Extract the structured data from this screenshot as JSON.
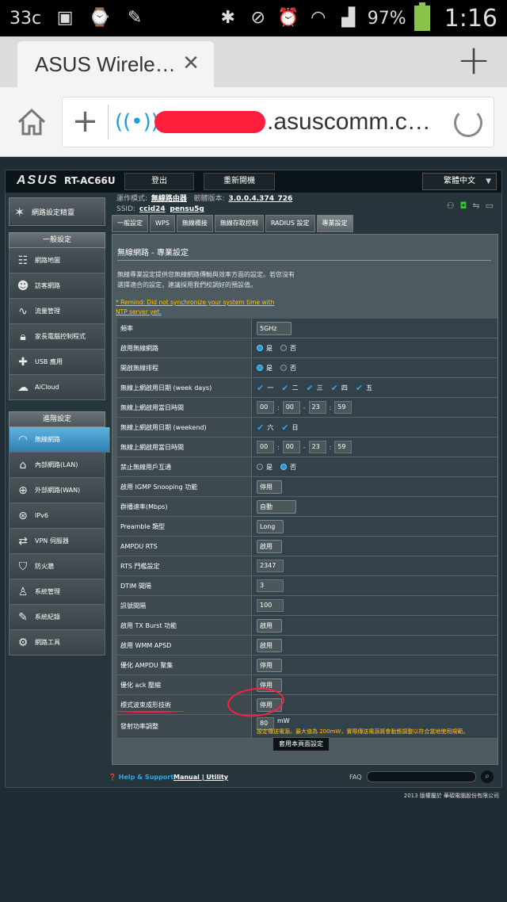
{
  "status_bar": {
    "temp": "33c",
    "battery": "97%",
    "time": "1:16"
  },
  "browser": {
    "tab_title": "ASUS Wirele…",
    "url": ".asuscomm.c…"
  },
  "router": {
    "logo": "ASUS",
    "model": "RT-AC66U",
    "logout": "登出",
    "reboot": "重新開機",
    "language": "繁體中文",
    "op_mode_label": "運作模式:",
    "op_mode": "無線路由器",
    "fw_label": "韌體版本:",
    "fw": "3.0.0.4.374_726",
    "ssid_label": "SSID:",
    "ssid1": "ccid24",
    "ssid2": "pensu5g"
  },
  "sidebar": {
    "wizard": "網路設定精靈",
    "general_head": "一般設定",
    "general": [
      "網路地圖",
      "訪客網路",
      "流量管理",
      "家長電腦控制程式",
      "USB 應用",
      "AiCloud"
    ],
    "advanced_head": "進階設定",
    "advanced": [
      "無線網路",
      "內部網路(LAN)",
      "外部網路(WAN)",
      "IPv6",
      "VPN 伺服器",
      "防火牆",
      "系統管理",
      "系統紀錄",
      "網路工具"
    ]
  },
  "tabs": [
    "一般設定",
    "WPS",
    "無線橋接",
    "無線存取控制",
    "RADIUS 設定",
    "專業設定"
  ],
  "page": {
    "title": "無線網路 - 專業設定",
    "desc": "無線專業設定提供您無線網路傳輸與效率方面的設定。若您沒有選擇適合的設定，建議採用我們校調好的預設值。",
    "remind": "* Remind: Did not synchronize your system time with NTP server yet.",
    "apply": "套用本頁面設定"
  },
  "rows": {
    "band": {
      "label": "頻率",
      "value": "5GHz"
    },
    "enable_radio": {
      "label": "啟用無線網路",
      "yes": "是",
      "no": "否"
    },
    "enable_sched": {
      "label": "開啟無線排程",
      "yes": "是",
      "no": "否"
    },
    "weekdays": {
      "label": "無線上網啟用日期 (week days)",
      "days": [
        "一",
        "二",
        "三",
        "四",
        "五"
      ]
    },
    "weekday_time": {
      "label": "無線上網啟用當日時間",
      "h1": "00",
      "m1": "00",
      "h2": "23",
      "m2": "59",
      "sep": ":",
      "dash": "-"
    },
    "weekend": {
      "label": "無線上網啟用日期 (weekend)",
      "days": [
        "六",
        "日"
      ]
    },
    "weekend_time": {
      "label": "無線上網啟用當日時間",
      "h1": "00",
      "m1": "00",
      "h2": "23",
      "m2": "59",
      "sep": ":",
      "dash": "-"
    },
    "ap_isolation": {
      "label": "禁止無線用戶互通",
      "yes": "是",
      "no": "否"
    },
    "igmp": {
      "label": "啟用 IGMP Snooping 功能",
      "value": "停用"
    },
    "mcast_rate": {
      "label": "群播速率(Mbps)",
      "value": "自動"
    },
    "preamble": {
      "label": "Preamble 類型",
      "value": "Long"
    },
    "ampdu_rts": {
      "label": "AMPDU RTS",
      "value": "啟用"
    },
    "rts": {
      "label": "RTS 門檻設定",
      "value": "2347"
    },
    "dtim": {
      "label": "DTIM 間隔",
      "value": "3"
    },
    "beacon": {
      "label": "訊號間隔",
      "value": "100"
    },
    "txburst": {
      "label": "啟用 TX Burst 功能",
      "value": "啟用"
    },
    "wmm_apsd": {
      "label": "啟用 WMM APSD",
      "value": "啟用"
    },
    "opt_ampdu": {
      "label": "優化 AMPDU 聚集",
      "value": "停用"
    },
    "opt_ack": {
      "label": "優化 ack 壓縮",
      "value": "停用"
    },
    "beamform": {
      "label": "標式波束成形技術",
      "value": "停用"
    },
    "txpower": {
      "label": "發射功率調整",
      "value": "80",
      "unit": "mW",
      "warn": "設定傳送電源。最大值為 200mW，實際傳送電源將會動態調整以符合當地使用規範。"
    }
  },
  "footer": {
    "help": "Help & Support",
    "manual": "Manual",
    "divider": "|",
    "utility": "Utility",
    "faq": "FAQ",
    "copyright": "2013 版權屬於 華碩電腦股份有限公司"
  }
}
